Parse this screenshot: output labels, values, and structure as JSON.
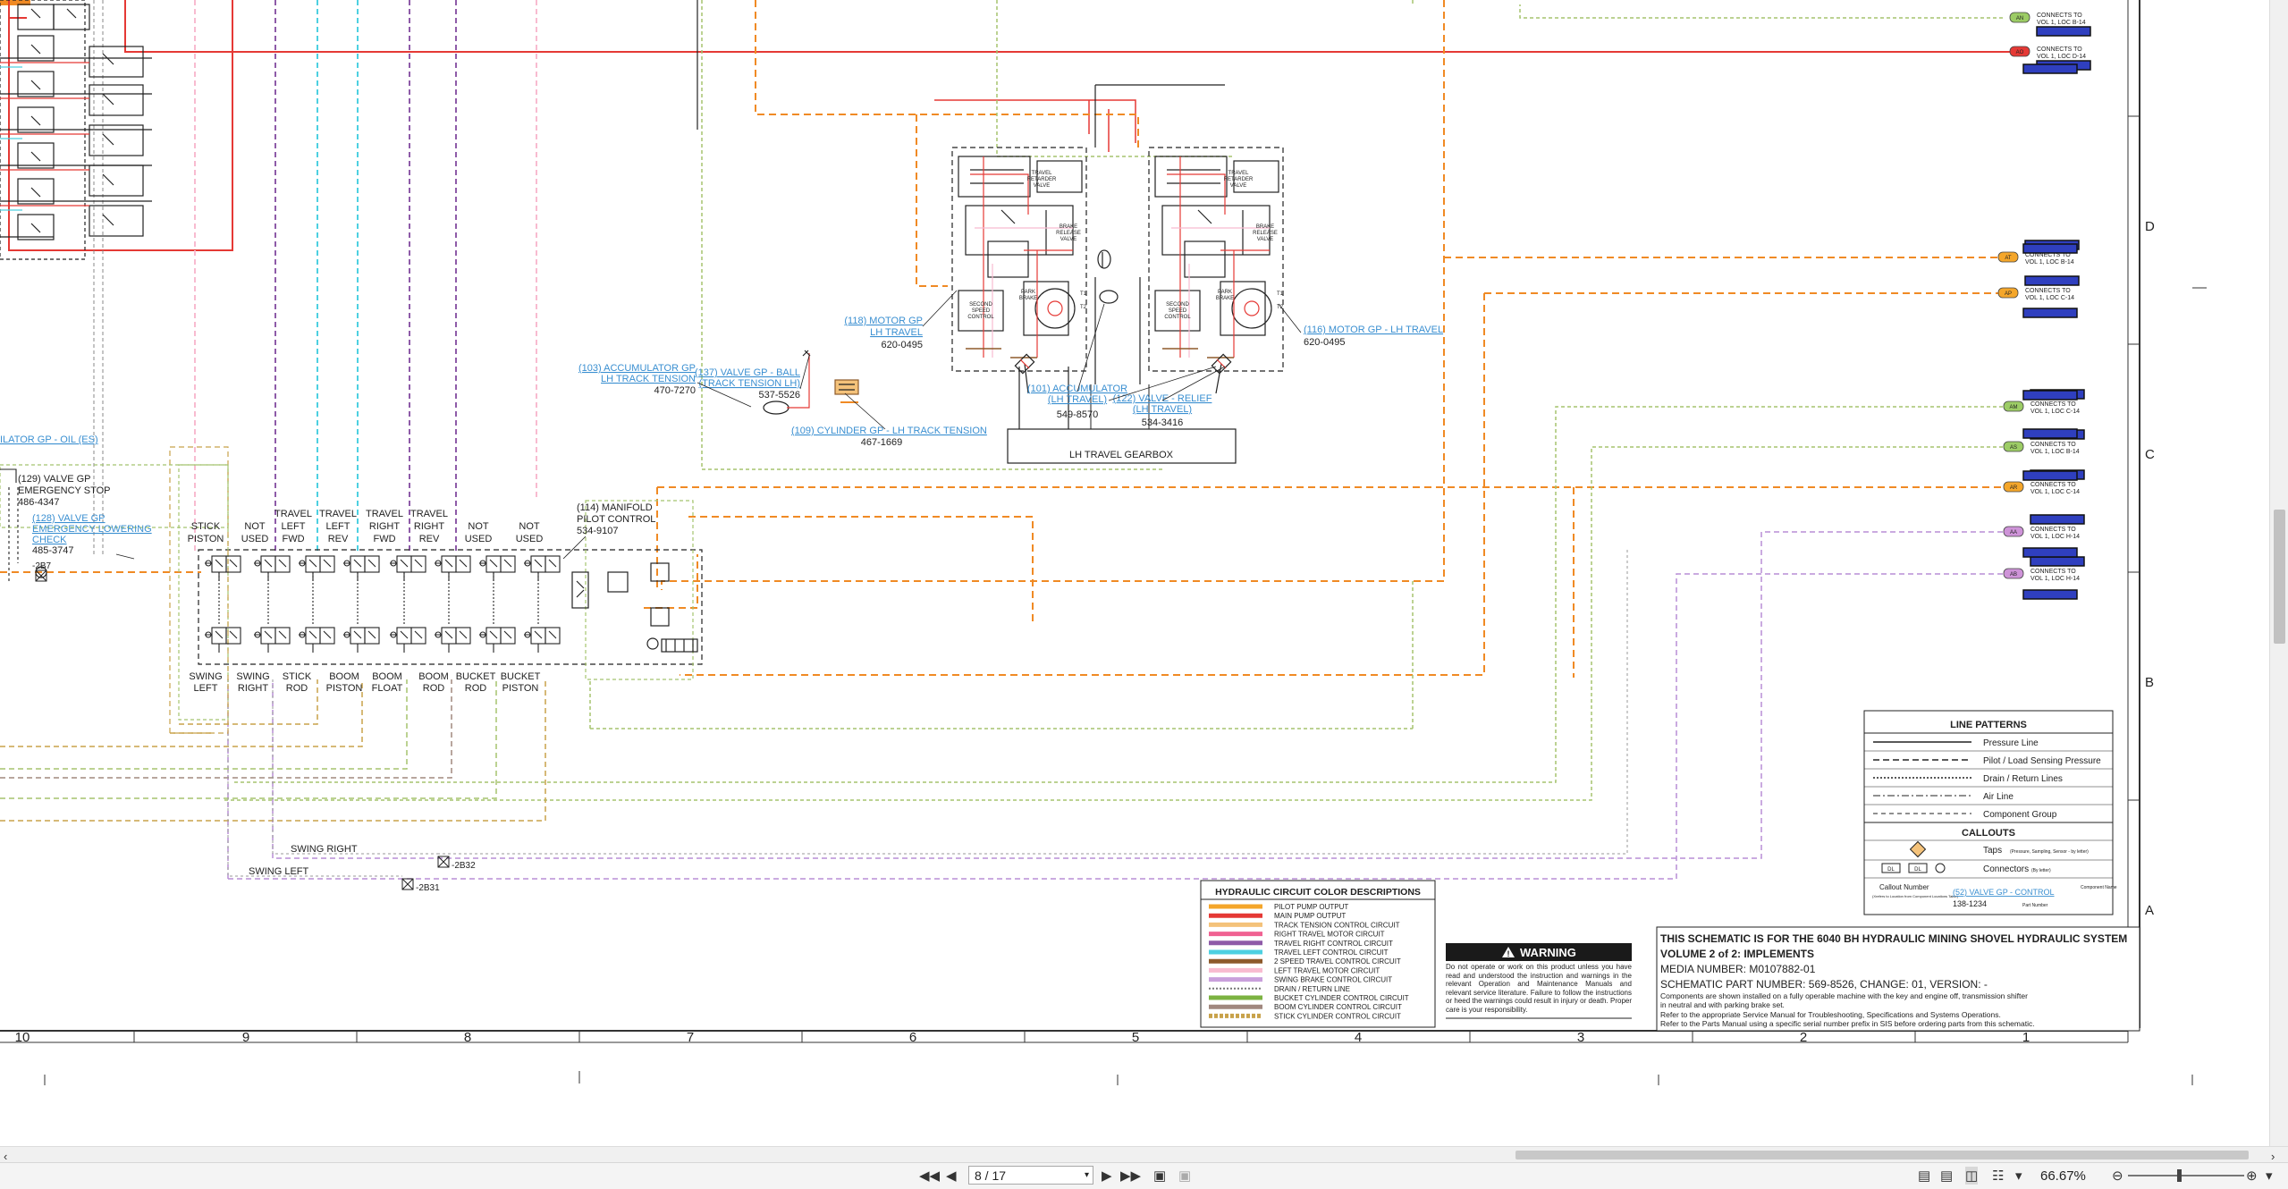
{
  "callouts": {
    "c129": {
      "title": "(129) VALVE GP",
      "sub": "EMERGENCY STOP",
      "part": "486-4347"
    },
    "c128": {
      "line1": "(128) VALVE GP",
      "line2": "EMERGENCY LOWERING",
      "line3": "CHECK",
      "part": "485-3747"
    },
    "c114": {
      "line1": "(114) MANIFOLD",
      "line2": "PILOT CONTROL",
      "part": "534-9107"
    },
    "c118": {
      "line1": "(118) MOTOR GP",
      "line2": "LH TRAVEL",
      "part": "620-0495"
    },
    "c116": {
      "line1": "(116) MOTOR GP - LH TRAVEL",
      "part": "620-0495"
    },
    "c103": {
      "line1": "(103) ACCUMULATOR GP",
      "line2": "LH TRACK TENSION",
      "part": "470-7270"
    },
    "c137": {
      "line1": "(137) VALVE GP - BALL",
      "line2": "(TRACK TENSION LH)",
      "part": "537-5526"
    },
    "c109": {
      "line1": "(109) CYLINDER GP - LH TRACK TENSION",
      "part": "467-1669"
    },
    "c101": {
      "line1": "(101) ACCUMULATOR",
      "line2": "(LH TRAVEL)",
      "part": "549-8570"
    },
    "c122": {
      "line1": "(122) VALVE - RELIEF",
      "line2": "(LH TRAVEL)",
      "part": "534-3416"
    },
    "oil": "ILATOR GP - OIL (ES)",
    "gearbox": "LH  TRAVEL   GEARBOX",
    "swing_right": "SWING   RIGHT",
    "swing_left": "SWING   LEFT",
    "b32": "-2B32",
    "b31": "-2B31",
    "b7": "-2B7"
  },
  "valve_top_labels": [
    {
      "l1": "",
      "l2": "STICK",
      "l3": "PISTON"
    },
    {
      "l1": "",
      "l2": "NOT",
      "l3": "USED"
    },
    {
      "l1": "TRAVEL",
      "l2": "LEFT",
      "l3": "FWD"
    },
    {
      "l1": "TRAVEL",
      "l2": "LEFT",
      "l3": "REV"
    },
    {
      "l1": "TRAVEL",
      "l2": "RIGHT",
      "l3": "FWD"
    },
    {
      "l1": "TRAVEL",
      "l2": "RIGHT",
      "l3": "REV"
    },
    {
      "l1": "",
      "l2": "NOT",
      "l3": "USED"
    },
    {
      "l1": "",
      "l2": "NOT",
      "l3": "USED"
    }
  ],
  "valve_bottom_labels": [
    {
      "l1": "SWING",
      "l2": "LEFT"
    },
    {
      "l1": "SWING",
      "l2": "RIGHT"
    },
    {
      "l1": "STICK",
      "l2": "ROD"
    },
    {
      "l1": "BOOM",
      "l2": "PISTON"
    },
    {
      "l1": "BOOM",
      "l2": "FLOAT"
    },
    {
      "l1": "BOOM",
      "l2": "ROD"
    },
    {
      "l1": "BUCKET",
      "l2": "ROD"
    },
    {
      "l1": "BUCKET",
      "l2": "PISTON"
    }
  ],
  "connectors": [
    {
      "tag": "AN",
      "text1": "CONNECTS TO",
      "text2": "VOL 1, LOC B-14",
      "color": "#9ccc65"
    },
    {
      "tag": "AO",
      "text1": "CONNECTS TO",
      "text2": "VOL 1, LOC D-14",
      "color": "#e53935"
    },
    {
      "tag": "AT",
      "text1": "CONNECTS TO",
      "text2": "VOL 1, LOC B-14",
      "color": "#f4a62a"
    },
    {
      "tag": "AP",
      "text1": "CONNECTS TO",
      "text2": "VOL 1, LOC C-14",
      "color": "#f4a62a"
    },
    {
      "tag": "AM",
      "text1": "CONNECTS TO",
      "text2": "VOL 1, LOC C-14",
      "color": "#9ccc65"
    },
    {
      "tag": "AS",
      "text1": "CONNECTS TO",
      "text2": "VOL 1, LOC B-14",
      "color": "#9ccc65"
    },
    {
      "tag": "AR",
      "text1": "CONNECTS TO",
      "text2": "VOL 1, LOC C-14",
      "color": "#f4a62a"
    },
    {
      "tag": "AA",
      "text1": "CONNECTS TO",
      "text2": "VOL 1, LOC H-14",
      "color": "#ce93d8"
    },
    {
      "tag": "AB",
      "text1": "CONNECTS TO",
      "text2": "VOL 1, LOC H-14",
      "color": "#ce93d8"
    }
  ],
  "motor_labels": {
    "left": "SECOND SPEED CONTROL",
    "right": "PARK BRAKE",
    "tr": "TRAVEL RETARDER VALVE",
    "br": "BRAKE RELEASE VALVE"
  },
  "zone_rows": [
    "D",
    "C",
    "B",
    "A"
  ],
  "zone_cols": [
    "10",
    "9",
    "8",
    "7",
    "6",
    "5",
    "4",
    "3",
    "2",
    "1"
  ],
  "line_patterns": {
    "title": "LINE PATTERNS",
    "items": [
      "Pressure Line",
      "Pilot / Load Sensing Pressure",
      "Drain / Return Lines",
      "Air Line",
      "Component Group"
    ],
    "callouts_title": "CALLOUTS",
    "taps": "Taps",
    "taps_note": "(Pressure, Sampling, Sensor - by letter)",
    "connectors": "Connectors",
    "connectors_note": "(By letter)",
    "callout_number": "Callout Number",
    "callout_number_note": "(Xrefers to Location from Component Locations Table)",
    "callout_example": "(52) VALVE GP - CONTROL",
    "component_name": "Component Name",
    "part_example": "138-1234",
    "part_number": "Part Number"
  },
  "color_desc": {
    "title": "HYDRAULIC CIRCUIT COLOR DESCRIPTIONS",
    "items": [
      {
        "label": "PILOT PUMP OUTPUT",
        "color": "#f4a62a",
        "style": "solid"
      },
      {
        "label": "MAIN PUMP OUTPUT",
        "color": "#e53935",
        "style": "solid"
      },
      {
        "label": "TRACK TENSION CONTROL CIRCUIT",
        "color": "#f4c27a",
        "style": "solid"
      },
      {
        "label": "RIGHT TRAVEL MOTOR CIRCUIT",
        "color": "#f06292",
        "style": "solid"
      },
      {
        "label": "TRAVEL RIGHT CONTROL CIRCUIT",
        "color": "#8e5ba8",
        "style": "solid"
      },
      {
        "label": "TRAVEL LEFT CONTROL CIRCUIT",
        "color": "#4dd0e1",
        "style": "solid"
      },
      {
        "label": "2 SPEED TRAVEL CONTROL CIRCUIT",
        "color": "#8d5a2b",
        "style": "solid"
      },
      {
        "label": "LEFT TRAVEL MOTOR CIRCUIT",
        "color": "#f8bbd0",
        "style": "solid"
      },
      {
        "label": "SWING BRAKE CONTROL CIRCUIT",
        "color": "#c9a0dc",
        "style": "solid"
      },
      {
        "label": "DRAIN / RETURN LINE",
        "color": "#777777",
        "style": "dotted"
      },
      {
        "label": "BUCKET CYLINDER CONTROL CIRCUIT",
        "color": "#7cb342",
        "style": "solid"
      },
      {
        "label": "BOOM CYLINDER CONTROL CIRCUIT",
        "color": "#a1887f",
        "style": "solid"
      },
      {
        "label": "STICK CYLINDER CONTROL CIRCUIT",
        "color": "#c8a24a",
        "style": "striped"
      }
    ]
  },
  "warning": {
    "title": "WARNING",
    "body": "Do not operate or work on this product unless you have read and understood the instruction and warnings in the relevant Operation and Maintenance Manuals and relevant service literature. Failure to follow the instructions or heed the warnings could result in injury or death. Proper care is your responsibility."
  },
  "title_block": {
    "line1": "THIS SCHEMATIC IS FOR THE 6040 BH HYDRAULIC MINING SHOVEL HYDRAULIC SYSTEM",
    "line2": "VOLUME 2 of 2: IMPLEMENTS",
    "media": "MEDIA NUMBER: M0107882-01",
    "part": "SCHEMATIC PART NUMBER: 569-8526, CHANGE: 01, VERSION: -",
    "n1": "Components are shown installed on a fully operable machine with the key and engine off, transmission shifter",
    "n2": "in neutral and with parking brake set.",
    "n3": "Refer to the appropriate Service Manual for Troubleshooting, Specifications and Systems Operations.",
    "n4": "Refer to the Parts Manual using a specific serial number prefix in SIS before ordering parts from this schematic."
  },
  "toolbar": {
    "page": "8 / 17",
    "zoom": "66.67%"
  }
}
